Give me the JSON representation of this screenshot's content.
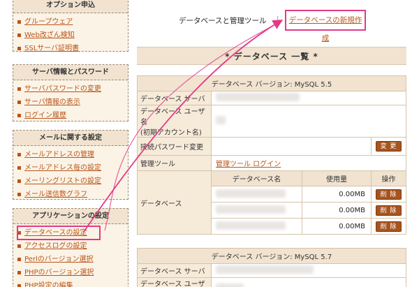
{
  "sidebar": {
    "options": {
      "title": "オプション申込",
      "items": [
        {
          "label": "グループウェア"
        },
        {
          "label": "Web改ざん検知"
        },
        {
          "label": "SSLサーバ証明書"
        }
      ]
    },
    "server": {
      "title": "サーバ情報とパスワード",
      "items": [
        {
          "label": "サーバパスワードの変更"
        },
        {
          "label": "サーバ情報の表示"
        },
        {
          "label": "ログイン履歴"
        }
      ]
    },
    "mail": {
      "title": "メールに関する設定",
      "items": [
        {
          "label": "メールアドレスの管理"
        },
        {
          "label": "メールアドレス毎の設定"
        },
        {
          "label": "メーリングリストの設定"
        },
        {
          "label": "メール送信数グラフ"
        }
      ]
    },
    "app": {
      "title": "アプリケーションの設定",
      "items": [
        {
          "label": "データベースの設定"
        },
        {
          "label": "アクセスログの設定"
        },
        {
          "label": "Perlのバージョン選択"
        },
        {
          "label": "PHPのバージョン選択"
        },
        {
          "label": "PHP設定の編集"
        }
      ]
    }
  },
  "topnav": {
    "current": "データベースと管理ツール",
    "separator": "|",
    "new_db": "データベースの新規作成"
  },
  "list_title": "* データベース 一覧 *",
  "databases": [
    {
      "version": "データベース バージョン: MySQL 5.5",
      "server_label": "データベース サーバ",
      "user_label": "データベース ユーザ名",
      "user_label_sub": "(初期アカウント名)",
      "password_label": "接続パスワード変更",
      "change_button": "変 更",
      "tool_label": "管理ツール",
      "tool_link": "管理ツール ログイン",
      "db_label": "データベース",
      "col_name": "データベース名",
      "col_usage": "使用量",
      "col_op": "操作",
      "rows": [
        {
          "usage": "0.00MB",
          "delete": "削 除"
        },
        {
          "usage": "0.00MB",
          "delete": "削 除"
        },
        {
          "usage": "0.00MB",
          "delete": "削 除"
        }
      ]
    },
    {
      "version": "データベース バージョン: MySQL 5.7",
      "server_label": "データベース サーバ",
      "user_label": "データベース ユーザ名"
    }
  ],
  "colors": {
    "accent": "#b8551a",
    "highlight": "#e23a86",
    "header_bg": "#f1e3d0"
  }
}
